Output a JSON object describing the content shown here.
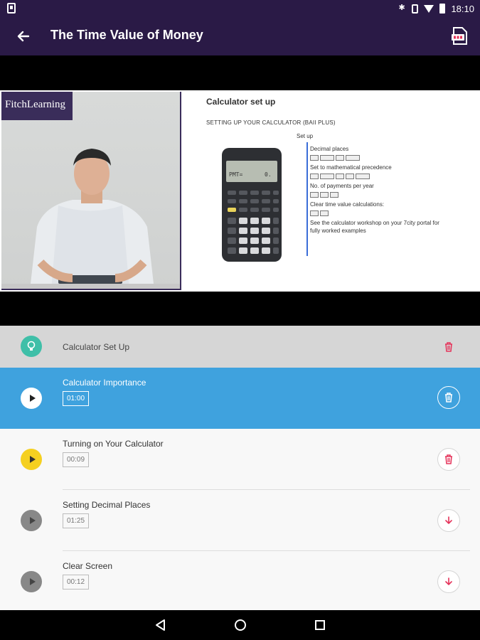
{
  "status_bar": {
    "time": "18:10",
    "icons": [
      "notification-icon",
      "bluetooth-icon",
      "vibrate-icon",
      "wifi-icon",
      "battery-icon"
    ]
  },
  "app_bar": {
    "title": "The Time Value of Money",
    "back_icon": "arrow-left-icon",
    "pdf_icon": "pdf-icon",
    "color": "#2a1a46"
  },
  "video": {
    "brand": "FitchLearning",
    "slide_title": "Calculator set up",
    "slide_subtitle": "SETTING UP YOUR CALCULATOR (BAII PLUS)",
    "setup_label": "Set up",
    "notes": [
      "Decimal places",
      "Set to mathematical precedence",
      "No. of payments per year",
      "Clear time value calculations:",
      "See the calculator workshop on your 7city portal for fully worked examples"
    ]
  },
  "playlist": {
    "section": {
      "title": "Calculator Set Up",
      "icon": "lightbulb-icon",
      "action_icon": "trash-icon"
    },
    "items": [
      {
        "title": "Calculator Importance",
        "duration": "01:00",
        "state": "active",
        "action_icon": "trash-icon"
      },
      {
        "title": "Turning on Your Calculator",
        "duration": "00:09",
        "state": "current",
        "action_icon": "trash-icon"
      },
      {
        "title": "Setting Decimal Places",
        "duration": "01:25",
        "state": "download",
        "action_icon": "download-icon"
      },
      {
        "title": "Clear Screen",
        "duration": "00:12",
        "state": "download",
        "action_icon": "download-icon"
      }
    ],
    "colors": {
      "active": "#3fa2de",
      "section_bg": "#d6d6d6",
      "accent_red": "#e5335a",
      "current_dot": "#f5d020",
      "section_dot": "#3fbfa8"
    }
  },
  "nav_bar": {
    "icons": [
      "back-triangle-icon",
      "home-circle-icon",
      "recents-square-icon"
    ]
  }
}
